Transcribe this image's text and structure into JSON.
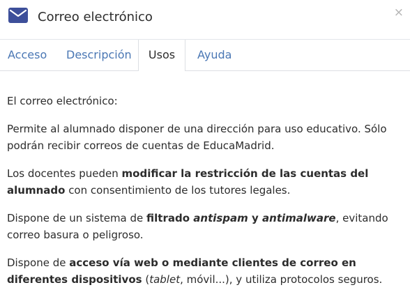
{
  "header": {
    "icon": "envelope-icon",
    "title": "Correo electrónico",
    "close_label": "×",
    "accent": "#3d4f9a"
  },
  "tabs": [
    {
      "label": "Acceso",
      "active": false
    },
    {
      "label": "Descripción",
      "active": false
    },
    {
      "label": "Usos",
      "active": true
    },
    {
      "label": "Ayuda",
      "active": false
    }
  ],
  "content": {
    "intro": "El correo electrónico:",
    "p1": "Permite al alumnado disponer de una dirección para uso educativo. Sólo podrán recibir correos de cuentas de EducaMadrid.",
    "p2": {
      "a": "Los docentes pueden ",
      "b": "modificar la restricción de las cuentas del alumnado",
      "c": " con consentimiento de los tutores legales."
    },
    "p3": {
      "a": "Dispone de un sistema de ",
      "b": "filtrado ",
      "bi1": "antispam",
      "b2": " y ",
      "bi2": "antimalware",
      "c": ", evitando correo basura o peligroso."
    },
    "p4": {
      "a": "Dispone de ",
      "b": "acceso vía web o mediante clientes de correo en diferentes dispositivos",
      "c": " (",
      "i": "tablet",
      "d": ", móvil...), y utiliza protocolos seguros."
    }
  },
  "colors": {
    "link": "#4a77b4",
    "text": "#2c2c2c",
    "border": "#dcdfe3"
  }
}
